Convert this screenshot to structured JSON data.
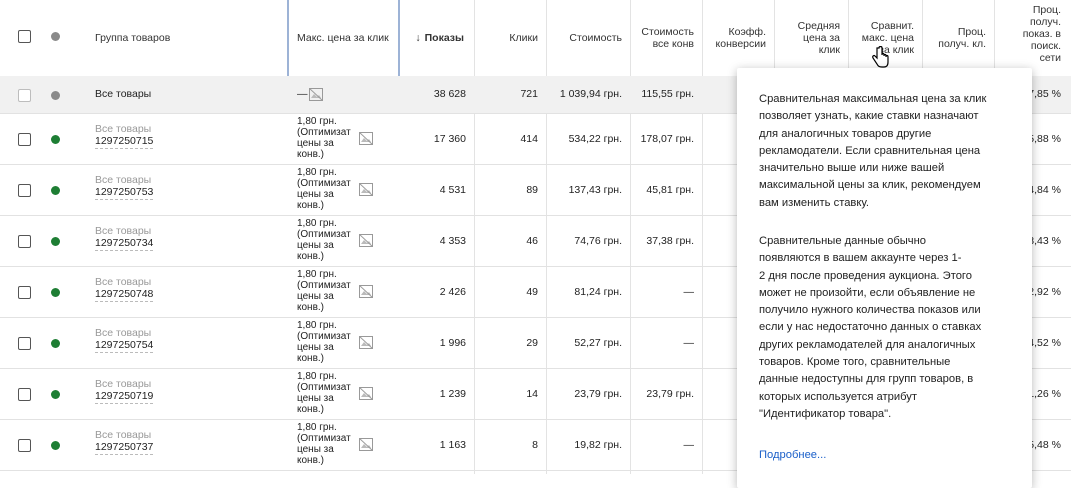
{
  "header": {
    "group_label": "Группа товаров",
    "max_cpc": "Макс. цена за клик",
    "impressions": "Показы",
    "sort_arrow": "↓",
    "clicks": "Клики",
    "cost": "Стоимость",
    "cost_per_conv": [
      "Стоимость",
      "все конв"
    ],
    "conv_rate": [
      "Коэфф.",
      "конверсии"
    ],
    "avg_cpc": [
      "Средняя",
      "цена за",
      "клик"
    ],
    "benchmark_max_cpc": [
      "Сравнит.",
      "макс. цена",
      "за клик"
    ],
    "search_impr_share": [
      "Проц.",
      "получ. кл."
    ],
    "search_impr_share2": [
      "Проц.",
      "получ.",
      "показ. в",
      "поиск.",
      "сети"
    ]
  },
  "total_row": {
    "name": "Все товары",
    "bid": "—",
    "impressions": "38 628",
    "clicks": "721",
    "cost": "1 039,94 грн.",
    "cost_per_conv": "115,55 грн.",
    "last": "7,85 %"
  },
  "bid_text": [
    "1,80 грн.",
    "(Оптимизат",
    "цены за",
    "конв.)"
  ],
  "rows": [
    {
      "name1": "Все товары",
      "name2": "1297250715",
      "impressions": "17 360",
      "clicks": "414",
      "cost": "534,22 грн.",
      "cost_per_conv": "178,07 грн.",
      "last": "5,88 %"
    },
    {
      "name1": "Все товары",
      "name2": "1297250753",
      "impressions": "4 531",
      "clicks": "89",
      "cost": "137,43 грн.",
      "cost_per_conv": "45,81 грн.",
      "last": "4,84 %"
    },
    {
      "name1": "Все товары",
      "name2": "1297250734",
      "impressions": "4 353",
      "clicks": "46",
      "cost": "74,76 грн.",
      "cost_per_conv": "37,38 грн.",
      "last": "3,43 %"
    },
    {
      "name1": "Все товары",
      "name2": "1297250748",
      "impressions": "2 426",
      "clicks": "49",
      "cost": "81,24 грн.",
      "cost_per_conv": "—",
      "last": "2,92 %"
    },
    {
      "name1": "Все товары",
      "name2": "1297250754",
      "impressions": "1 996",
      "clicks": "29",
      "cost": "52,27 грн.",
      "cost_per_conv": "—",
      "last": "4,52 %"
    },
    {
      "name1": "Все товары",
      "name2": "1297250719",
      "impressions": "1 239",
      "clicks": "14",
      "cost": "23,79 грн.",
      "cost_per_conv": "23,79 грн.",
      "last": "1,26 %"
    },
    {
      "name1": "Все товары",
      "name2": "1297250737",
      "impressions": "1 163",
      "clicks": "8",
      "cost": "19,82 грн.",
      "cost_per_conv": "—",
      "last": "5,48 %"
    }
  ],
  "tooltip": {
    "para1": [
      "Сравнительная максимальная цена за клик",
      "позволяет узнать, какие ставки назначают",
      "для аналогичных товаров другие",
      "рекламодатели. Если сравнительная цена",
      "значительно выше или ниже вашей",
      "максимальной цены за клик, рекомендуем",
      "вам изменить ставку."
    ],
    "para2": [
      "Сравнительные данные обычно",
      "появляются в вашем аккаунте через 1-",
      "2 дня после проведения аукциона. Этого",
      "может не произойти, если объявление не",
      "получило нужного количества показов или",
      "если у нас недостаточно данных о ставках",
      "других рекламодателей для аналогичных",
      "товаров. Кроме того, сравнительные",
      "данные недоступны для групп товаров, в",
      "которых используется атрибут",
      "\"Идентификатор товара\"."
    ],
    "link": "Подробнее..."
  },
  "colors": {
    "status_green": "#1e7e34",
    "status_grey": "#8a8a8a",
    "link": "#1a5fc9"
  }
}
